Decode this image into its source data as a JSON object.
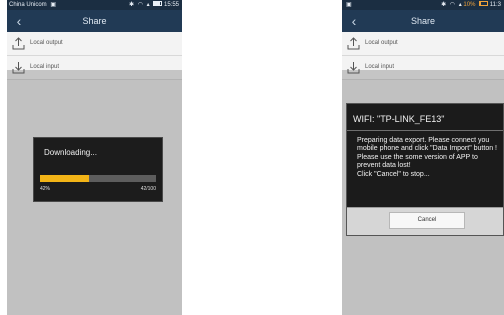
{
  "left_phone": {
    "status": {
      "carrier": "China Unicom",
      "carrier_icon": "sim-icon",
      "icons": "✑ ⌐ ▐",
      "time": "15:55"
    },
    "title": "Share",
    "menu": [
      {
        "label": "Local output",
        "icon": "upload-icon"
      },
      {
        "label": "Local input",
        "icon": "download-icon"
      }
    ],
    "dialog": {
      "message": "Downloading...",
      "progress": 0.42,
      "percent_label": "42%",
      "count_label": "42/100",
      "accent": "#f2b417"
    }
  },
  "right_phone": {
    "status": {
      "battery_text": "10%",
      "time": "11:3"
    },
    "title": "Share",
    "menu": [
      {
        "label": "Local output",
        "icon": "upload-icon"
      },
      {
        "label": "Local input",
        "icon": "download-icon"
      }
    ],
    "dialog": {
      "title": "WIFI: \"TP-LINK_FE13\"",
      "body": "Preparing data export. Please connect you mobile phone and click \"Data Import\" button !\n Please use the some version of APP to prevent data lost!\nClick \"Cancel\" to stop...",
      "cancel_label": "Cancel"
    }
  }
}
